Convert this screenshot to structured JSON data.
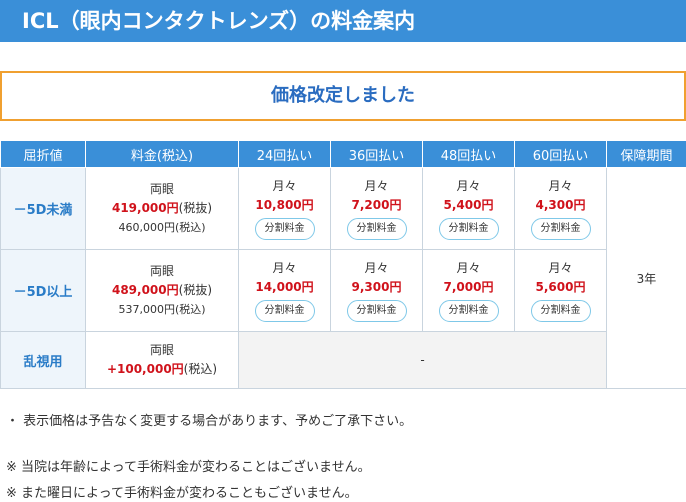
{
  "title": "ICL（眼内コンタクトレンズ）の料金案内",
  "notice": "価格改定しました",
  "table": {
    "headers": [
      "屈折値",
      "料金(税込)",
      "24回払い",
      "36回払い",
      "48回払い",
      "60回払い",
      "保障期間"
    ],
    "monthly_label": "月々",
    "installment_button": "分割料金",
    "rows": [
      {
        "label": "－5D未満",
        "eyes": "両眼",
        "price": "419,000円",
        "price_suffix": "(税抜)",
        "price_incl": "460,000円(税込)",
        "monthly": [
          "10,800円",
          "7,200円",
          "5,400円",
          "4,300円"
        ]
      },
      {
        "label": "－5D以上",
        "eyes": "両眼",
        "price": "489,000円",
        "price_suffix": "(税抜)",
        "price_incl": "537,000円(税込)",
        "monthly": [
          "14,000円",
          "9,300円",
          "7,000円",
          "5,600円"
        ]
      },
      {
        "label": "乱視用",
        "eyes": "両眼",
        "price": "+100,000円",
        "price_suffix": "(税込)",
        "installment": "-"
      }
    ],
    "warranty": "3年"
  },
  "notes": [
    "・ 表示価格は予告なく変更する場合があります、予めご了承下さい。",
    "※ 当院は年齢によって手術料金が変わることはございません。",
    "※ また曜日によって手術料金が変わることもございません。"
  ],
  "colors": {
    "header_blue": "#3a8fd8",
    "notice_border": "#f0a030",
    "price_red": "#d0121b",
    "pill_border": "#7fc8e8"
  }
}
